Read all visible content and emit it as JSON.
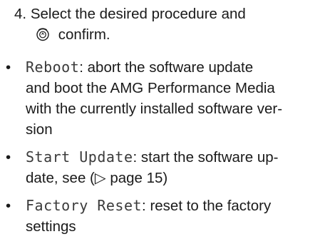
{
  "step": {
    "number": "4.",
    "text_line1": "Select the desired procedure and",
    "confirm_icon": "controller-press-icon",
    "text_line2": "confirm."
  },
  "options": [
    {
      "term": "Reboot",
      "separator": ":",
      "description_lines": [
        "abort the software update",
        "and boot the AMG Performance Media",
        "with the currently installed software ver-",
        "sion"
      ]
    },
    {
      "term": "Start Update",
      "separator": ":",
      "description_lines": [
        "start the software up-",
        "date, see (▷ page 15)"
      ]
    },
    {
      "term": "Factory Reset",
      "separator": ":",
      "description_lines": [
        "reset to the factory",
        "settings"
      ]
    }
  ]
}
